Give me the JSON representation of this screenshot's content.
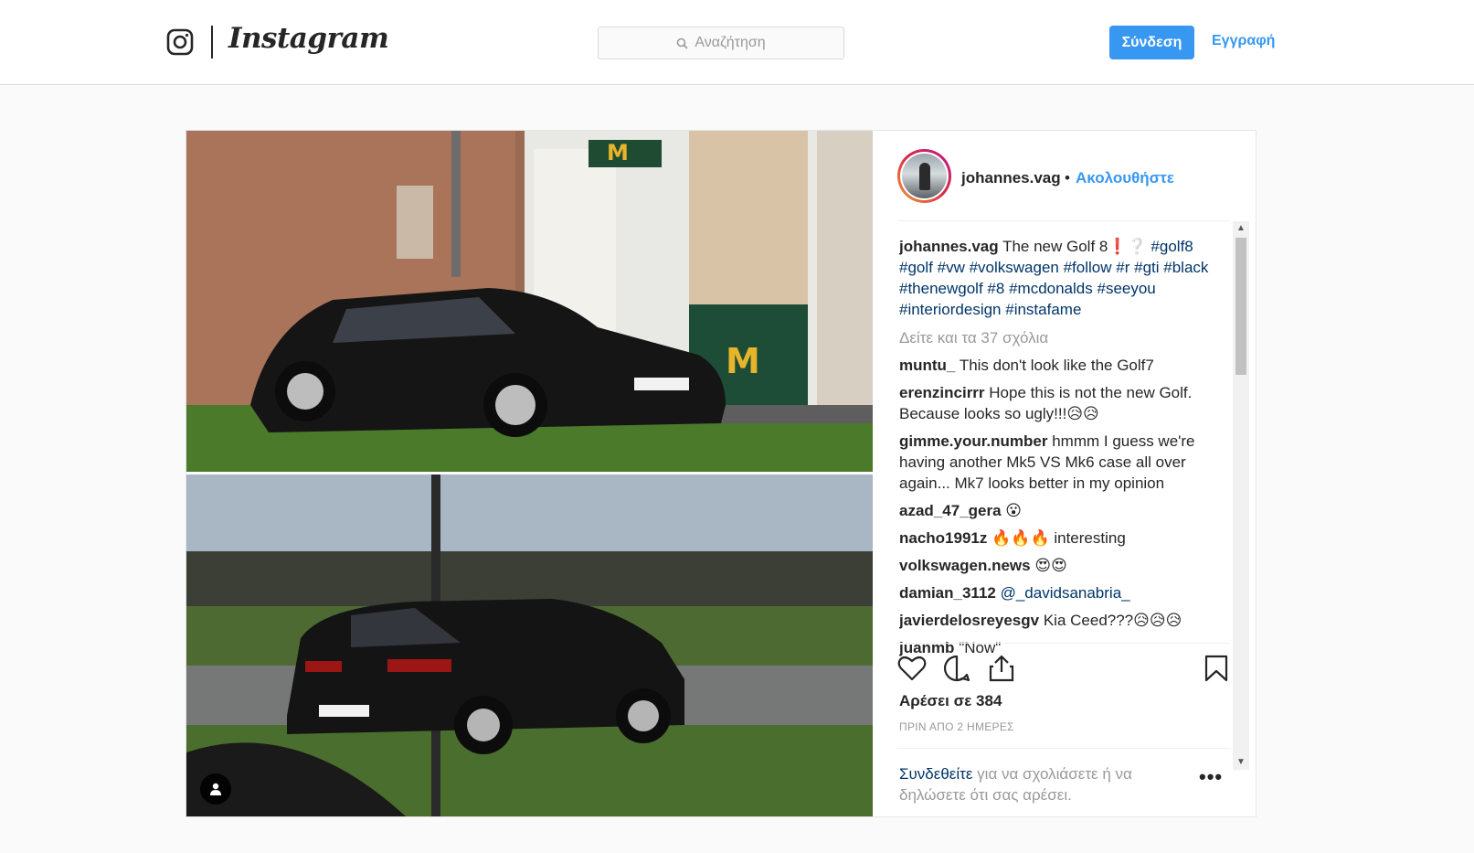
{
  "nav": {
    "logo_text": "Instagram",
    "search_placeholder": "Αναζήτηση",
    "login_label": "Σύνδεση",
    "signup_label": "Εγγραφή"
  },
  "post": {
    "username": "johannes.vag",
    "follow_separator": "•",
    "follow_label": "Ακολουθήστε",
    "caption": {
      "username": "johannes.vag",
      "text": "The new Golf 8❗❔",
      "hashtags": [
        "#golf8",
        "#golf",
        "#vw",
        "#volkswagen",
        "#follow",
        "#r",
        "#gti",
        "#black",
        "#thenewgolf",
        "#8",
        "#mcdonalds",
        "#seeyou",
        "#interiordesign",
        "#instafame"
      ]
    },
    "view_all_comments": "Δείτε και τα 37 σχόλια",
    "comments": [
      {
        "user": "muntu_",
        "text": "This don't look like the Golf7"
      },
      {
        "user": "erenzincirrr",
        "text": "Hope this is not the new Golf. Because looks so ugly!!!😥😥"
      },
      {
        "user": "gimme.your.number",
        "text": "hmmm I guess we're having another Mk5 VS Mk6 case all over again... Mk7 looks better in my opinion"
      },
      {
        "user": "azad_47_gera",
        "text": "😮"
      },
      {
        "user": "nacho1991z",
        "text": "🔥🔥🔥 interesting"
      },
      {
        "user": "volkswagen.news",
        "text": "😍😍"
      },
      {
        "user": "damian_3112",
        "mention": "@_davidsanabria_",
        "text": ""
      },
      {
        "user": "javierdelosreyesgv",
        "text": "Kia Ceed???😥😥😥"
      },
      {
        "user": "juanmb",
        "text": "\"Now\""
      }
    ],
    "likes_text": "Αρέσει σε 384",
    "timestamp": "ΠΡΙΝ ΑΠΟ 2 ΗΜΕΡΕΣ",
    "login_to_comment_link": "Συνδεθείτε",
    "login_to_comment_rest": " για να σχολιάσετε ή να δηλώσετε ότι σας αρέσει.",
    "more_label": "•••"
  },
  "colors": {
    "accent": "#3897f0",
    "hashtag": "#003569",
    "muted": "#999999",
    "border": "#dbdbdb"
  },
  "icons": [
    "instagram-glyph-icon",
    "search-icon",
    "heart-icon",
    "comment-icon",
    "share-icon",
    "bookmark-icon",
    "user-tag-icon"
  ]
}
